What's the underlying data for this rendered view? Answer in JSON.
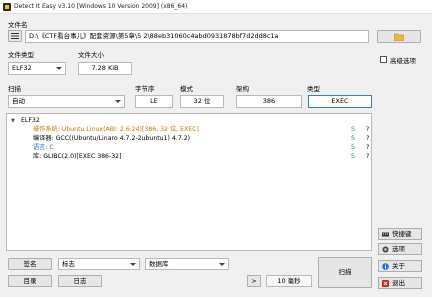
{
  "window": {
    "title": "Detect It Easy v3.10 [Windows 10 Version 2009] (x86_64)"
  },
  "file_name": {
    "label": "文件名",
    "value": "D:\\《CTF看台事儿》配套资源\\第5章\\5 2\\88eb31060c4abd0931878bf7d2dd8c1a",
    "browse_label": "..."
  },
  "file_type": {
    "label": "文件类型",
    "value": "ELF32"
  },
  "file_size": {
    "label": "文件大小",
    "value": "7.28 KiB"
  },
  "advanced": {
    "label": "高级选项",
    "checked": false
  },
  "scan": {
    "label": "扫描",
    "mode_value": "自动",
    "endian_label": "字节序",
    "endian_value": "LE",
    "mode_label": "模式",
    "bits_value": "32 位",
    "arch_label": "架构",
    "arch_value": "386",
    "type_label": "类型",
    "type_value": "EXEC"
  },
  "results": {
    "root": "ELF32",
    "rows": [
      {
        "text": "操作系统: Ubuntu Linux(ABI: 2.6.24)[386, 32 位, EXEC]",
        "s": "S",
        "q": "?",
        "color": "#c07a00"
      },
      {
        "text": "编译器: GCC((Ubuntu/Linaro 4.7.2-2ubuntu1) 4.7.2)",
        "s": "S",
        "q": "?",
        "color": "#000000"
      },
      {
        "text": "语言: C",
        "s": "S",
        "q": "?",
        "color": "#1f6fb0"
      },
      {
        "text": "库: GLIBC(2.0)[EXEC 386-32]",
        "s": "S",
        "q": "?",
        "color": "#000000"
      }
    ]
  },
  "side_buttons": {
    "shortcuts": "快捷键",
    "options": "选项",
    "about": "关于",
    "exit": "退出"
  },
  "bottom": {
    "signature_label": "签名",
    "log_combo_value": "标志",
    "database_combo_value": "数据库",
    "directory_label": "目录",
    "log_label": "日志",
    "arrow_label": ">",
    "time_value": "10 毫秒",
    "scan_button_label": "扫描"
  },
  "colors": {
    "accent_border": "#3c7fb1",
    "ok_green": "#2e8b57"
  }
}
